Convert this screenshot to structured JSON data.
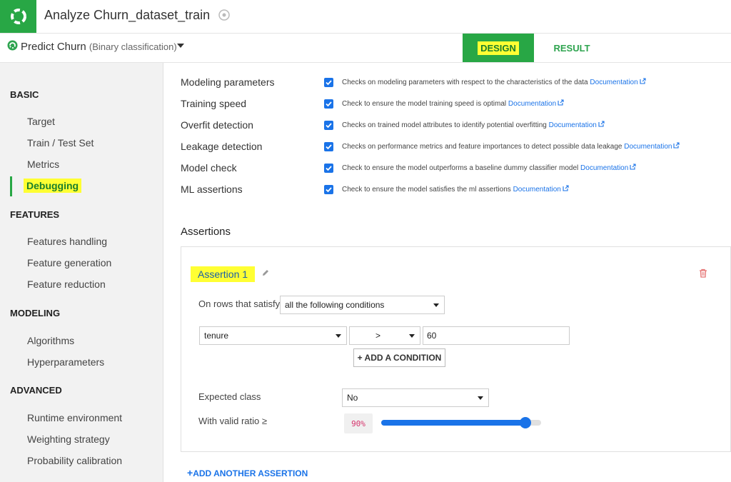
{
  "header": {
    "title": "Analyze Churn_dataset_train",
    "logo_icon": "dataiku-logo-icon",
    "title_icon": "compass-icon",
    "brand_color": "#28a745"
  },
  "subheader": {
    "model_name": "Predict Churn",
    "model_type": "(Binary classification)",
    "tabs": {
      "design": "DESIGN",
      "result": "RESULT"
    }
  },
  "sidebar": {
    "sections": [
      {
        "title": "BASIC",
        "items": [
          "Target",
          "Train / Test Set",
          "Metrics",
          "Debugging"
        ]
      },
      {
        "title": "FEATURES",
        "items": [
          "Features handling",
          "Feature generation",
          "Feature reduction"
        ]
      },
      {
        "title": "MODELING",
        "items": [
          "Algorithms",
          "Hyperparameters"
        ]
      },
      {
        "title": "ADVANCED",
        "items": [
          "Runtime environment",
          "Weighting strategy",
          "Probability calibration"
        ]
      }
    ],
    "active_item": "Debugging"
  },
  "checks": [
    {
      "label": "Modeling parameters",
      "checked": true,
      "desc": "Checks on modeling parameters with respect to the characteristics of the data",
      "link": "Documentation"
    },
    {
      "label": "Training speed",
      "checked": true,
      "desc": "Check to ensure the model training speed is optimal",
      "link": "Documentation"
    },
    {
      "label": "Overfit detection",
      "checked": true,
      "desc": "Checks on trained model attributes to identify potential overfitting",
      "link": "Documentation"
    },
    {
      "label": "Leakage detection",
      "checked": true,
      "desc": "Checks on performance metrics and feature importances to detect possible data leakage",
      "link": "Documentation"
    },
    {
      "label": "Model check",
      "checked": true,
      "desc": "Check to ensure the model outperforms a baseline dummy classifier model",
      "link": "Documentation"
    },
    {
      "label": "ML assertions",
      "checked": true,
      "desc": "Check to ensure the model satisfies the ml assertions",
      "link": "Documentation"
    }
  ],
  "assertions": {
    "title": "Assertions",
    "card": {
      "name": "Assertion 1",
      "rows_label": "On rows that satisfy",
      "rows_mode": "all the following conditions",
      "condition": {
        "column": "tenure",
        "operator": ">",
        "value": "60"
      },
      "add_condition": "+ ADD A CONDITION",
      "expected_class_label": "Expected class",
      "expected_class": "No",
      "valid_ratio_label": "With valid ratio ≥",
      "valid_ratio": "90%",
      "valid_ratio_fraction": 0.9
    },
    "add_another": "ADD ANOTHER ASSERTION"
  }
}
